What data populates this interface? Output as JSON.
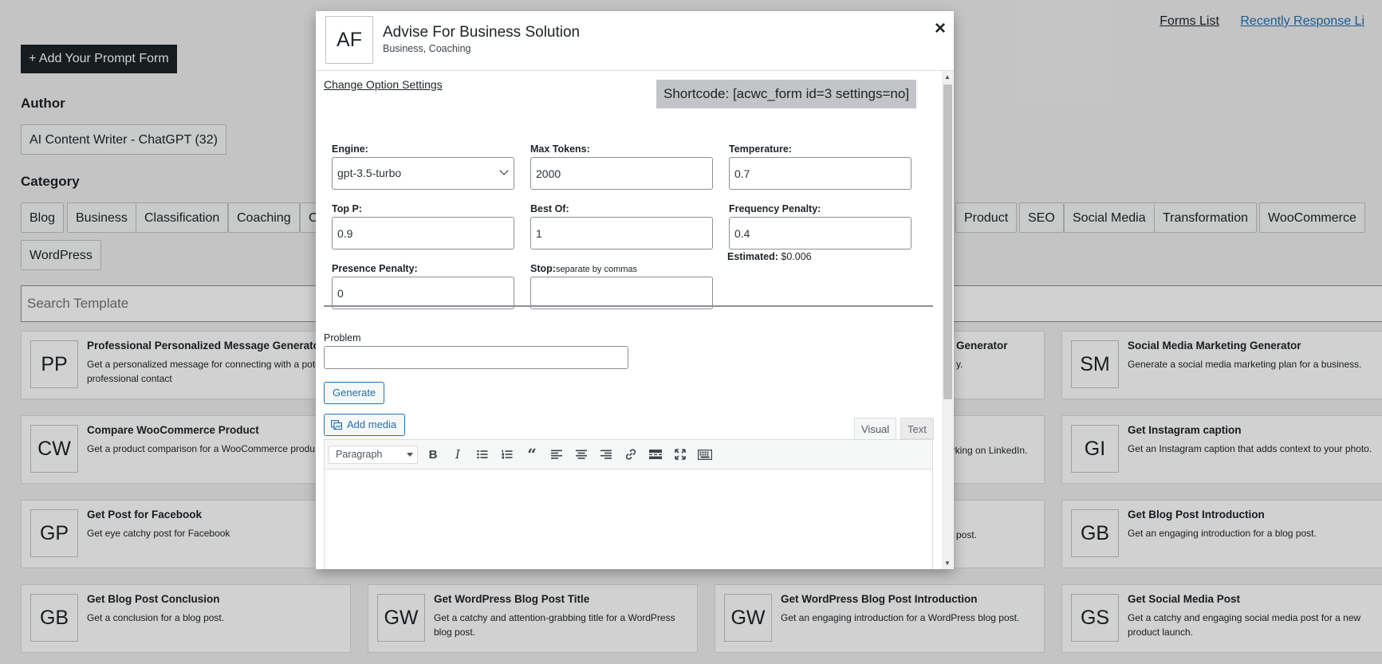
{
  "top_links": {
    "forms_list": "Forms List",
    "recent": "Recently Response Li"
  },
  "add_button": "+ Add Your Prompt Form",
  "author": {
    "title": "Author",
    "items": [
      "AI Content Writer - ChatGPT (32)"
    ]
  },
  "category": {
    "title": "Category",
    "row1_left": [
      "Blog",
      "Business",
      "Classification",
      "Coaching",
      "C"
    ],
    "row1_right": [
      "Product",
      "SEO",
      "Social Media",
      "Transformation",
      "WooCommerce"
    ],
    "row2": [
      "WordPress"
    ]
  },
  "search_placeholder": "Search Template",
  "cards": [
    {
      "abbr": "PP",
      "title": "Professional Personalized Message Generator",
      "desc": "Get a personalized message for connecting with a potential professional contact"
    },
    {
      "abbr": "",
      "title": "Generator",
      "desc": "y."
    },
    {
      "abbr": "SM",
      "title": "Social Media Marketing Generator",
      "desc": "Generate a social media marketing plan for a business."
    },
    {
      "abbr": "CW",
      "title": "Compare WooCommerce Product",
      "desc": "Get a product comparison for a WooCommerce produ"
    },
    {
      "abbr": "",
      "title": "",
      "desc": "orking on LinkedIn."
    },
    {
      "abbr": "GI",
      "title": "Get Instagram caption",
      "desc": "Get an Instagram caption that adds context to your photo."
    },
    {
      "abbr": "GP",
      "title": "Get Post for Facebook",
      "desc": "Get eye catchy post for Facebook"
    },
    {
      "abbr": "",
      "title": "",
      "desc": "post."
    },
    {
      "abbr": "GB",
      "title": "Get Blog Post Introduction",
      "desc": "Get an engaging introduction for a blog post."
    },
    {
      "abbr": "GB",
      "title": "Get Blog Post Conclusion",
      "desc": "Get a conclusion for a blog post."
    },
    {
      "abbr": "GW",
      "title": "Get WordPress Blog Post Title",
      "desc": "Get a catchy and attention-grabbing title for a WordPress blog post."
    },
    {
      "abbr": "GW",
      "title": "Get WordPress Blog Post Introduction",
      "desc": "Get an engaging introduction for a WordPress blog post."
    },
    {
      "abbr": "GS",
      "title": "Get Social Media Post",
      "desc": "Get a catchy and engaging social media post for a new product launch."
    }
  ],
  "modal": {
    "logo": "AF",
    "title": "Advise For Business Solution",
    "subtitle": "Business, Coaching",
    "close": "×",
    "change_link": "Change Option Settings",
    "shortcode": "Shortcode: [acwc_form id=3 settings=no]",
    "fields": {
      "engine": {
        "label": "Engine:",
        "value": "gpt-3.5-turbo"
      },
      "max_tokens": {
        "label": "Max Tokens:",
        "value": "2000"
      },
      "temperature": {
        "label": "Temperature:",
        "value": "0.7"
      },
      "top_p": {
        "label": "Top P:",
        "value": "0.9"
      },
      "best_of": {
        "label": "Best Of:",
        "value": "1"
      },
      "frequency_penalty": {
        "label": "Frequency Penalty:",
        "value": "0.4"
      },
      "presence_penalty": {
        "label": "Presence Penalty:",
        "value": "0"
      },
      "stop": {
        "label": "Stop:",
        "hint": "separate by commas",
        "value": ""
      }
    },
    "estimated": {
      "label": "Estimated:",
      "value": "$0.006"
    },
    "problem_label": "Problem",
    "generate": "Generate",
    "add_media": "Add media",
    "tabs": {
      "visual": "Visual",
      "text": "Text"
    },
    "editor": {
      "format": "Paragraph"
    }
  }
}
